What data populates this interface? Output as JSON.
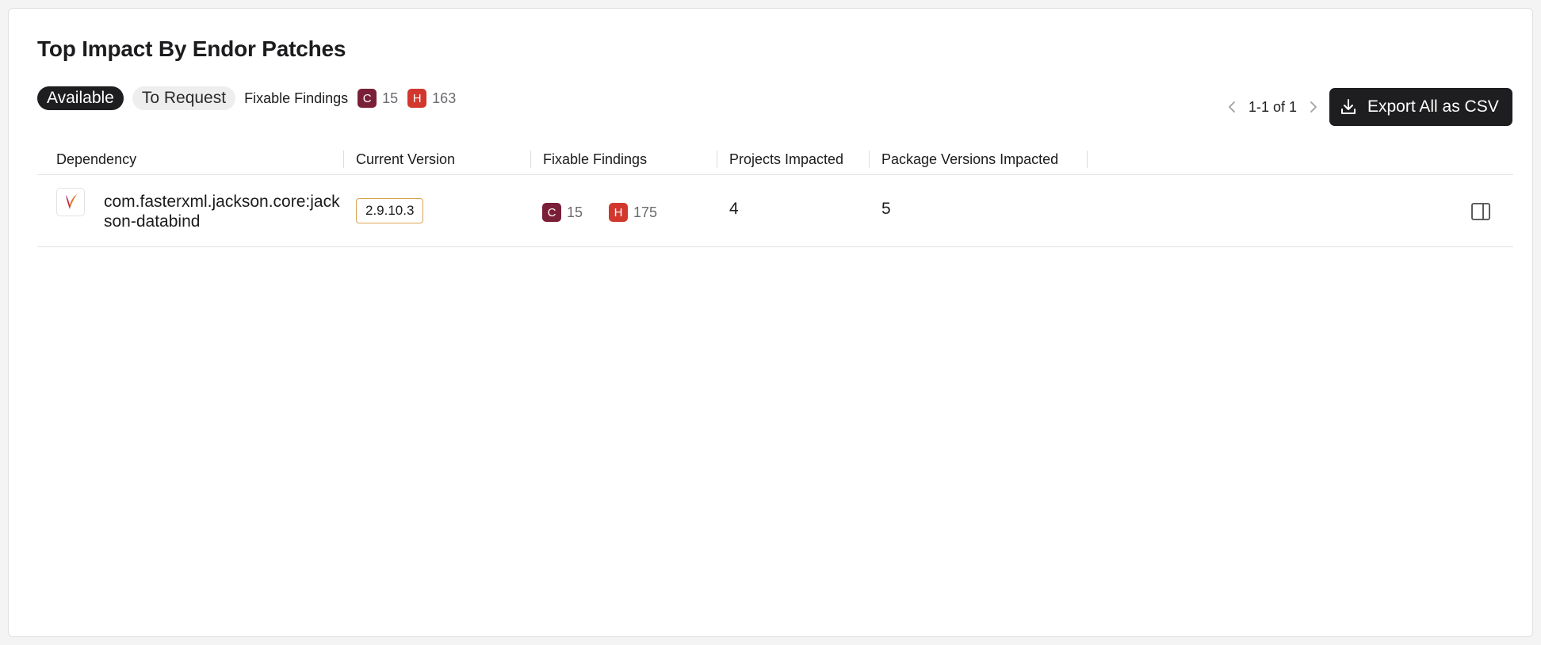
{
  "panel": {
    "title": "Top Impact By Endor Patches"
  },
  "toolbar": {
    "tab_available": "Available",
    "tab_to_request": "To Request",
    "fixable_label": "Fixable Findings",
    "critical_letter": "C",
    "critical_count": "15",
    "high_letter": "H",
    "high_count": "163"
  },
  "pagination": {
    "text": "1-1 of 1"
  },
  "export": {
    "label": "Export All as CSV",
    "icon": "download-icon"
  },
  "table": {
    "columns": [
      "Dependency",
      "Current Version",
      "Fixable Findings",
      "Projects Impacted",
      "Package Versions Impacted"
    ],
    "rows": [
      {
        "dependency": "com.fasterxml.jackson.core:jackson-databind",
        "dependency_icon": "maven-feather-icon",
        "current_version": "2.9.10.3",
        "critical_letter": "C",
        "critical": "15",
        "high_letter": "H",
        "high": "175",
        "projects_impacted": "4",
        "package_versions_impacted": "5",
        "action_icon": "side-panel-icon"
      }
    ]
  },
  "colors": {
    "critical": "#7a1f38",
    "high": "#d2372d",
    "button_dark": "#1e1e20",
    "version_border": "#d7a452"
  }
}
